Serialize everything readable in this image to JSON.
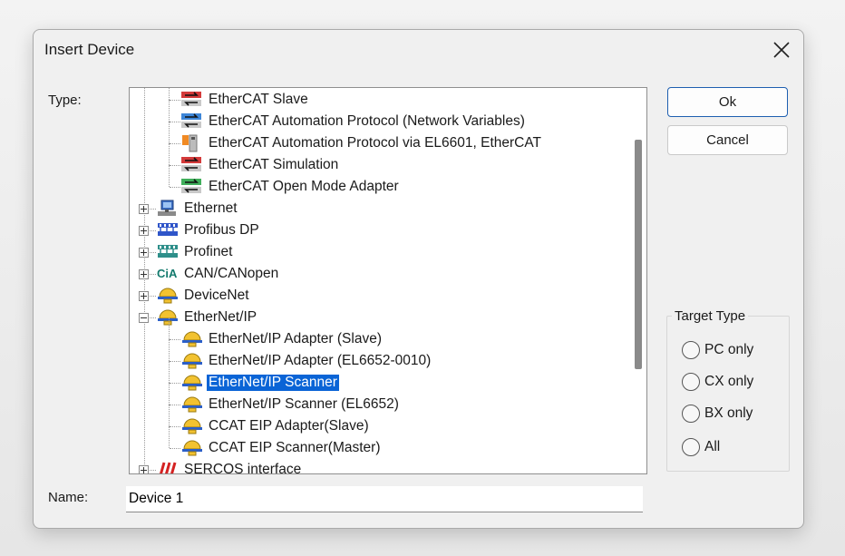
{
  "dialog": {
    "title": "Insert Device",
    "close_icon": "close-icon"
  },
  "type_label": "Type:",
  "tree": {
    "items": [
      {
        "label": "EtherCAT Slave",
        "icon": "ethercat-slave-icon",
        "level": 2
      },
      {
        "label": "EtherCAT Automation Protocol (Network Variables)",
        "icon": "ethercat-automation-icon",
        "level": 2
      },
      {
        "label": "EtherCAT Automation Protocol via EL6601, EtherCAT",
        "icon": "el6601-icon",
        "level": 2
      },
      {
        "label": "EtherCAT Simulation",
        "icon": "ethercat-simulation-icon",
        "level": 2
      },
      {
        "label": "EtherCAT Open Mode Adapter",
        "icon": "ethercat-open-mode-icon",
        "level": 2
      },
      {
        "label": "Ethernet",
        "icon": "ethernet-icon",
        "level": 1,
        "expander": "plus"
      },
      {
        "label": "Profibus DP",
        "icon": "profibus-icon",
        "level": 1,
        "expander": "plus"
      },
      {
        "label": "Profinet",
        "icon": "profinet-icon",
        "level": 1,
        "expander": "plus"
      },
      {
        "label": "CAN/CANopen",
        "icon": "cia-icon",
        "level": 1,
        "expander": "plus"
      },
      {
        "label": "DeviceNet",
        "icon": "devicenet-icon",
        "level": 1,
        "expander": "plus"
      },
      {
        "label": "EtherNet/IP",
        "icon": "ethernetip-icon",
        "level": 1,
        "expander": "minus"
      },
      {
        "label": "EtherNet/IP Adapter (Slave)",
        "icon": "ethernetip-device-icon",
        "level": 2
      },
      {
        "label": "EtherNet/IP Adapter (EL6652-0010)",
        "icon": "ethernetip-device-icon",
        "level": 2
      },
      {
        "label": "EtherNet/IP Scanner",
        "icon": "ethernetip-device-icon",
        "level": 2,
        "selected": true
      },
      {
        "label": "EtherNet/IP Scanner (EL6652)",
        "icon": "ethernetip-device-icon",
        "level": 2
      },
      {
        "label": "CCAT EIP Adapter(Slave)",
        "icon": "ethernetip-device-icon",
        "level": 2
      },
      {
        "label": "CCAT EIP Scanner(Master)",
        "icon": "ethernetip-device-icon",
        "level": 2
      },
      {
        "label": "SERCOS interface",
        "icon": "sercos-icon",
        "level": 1,
        "expander": "plus"
      }
    ]
  },
  "buttons": {
    "ok": "Ok",
    "cancel": "Cancel"
  },
  "target_type": {
    "legend": "Target Type",
    "options": [
      "PC only",
      "CX only",
      "BX only",
      "All"
    ]
  },
  "name_field": {
    "label": "Name:",
    "value": "Device 1"
  }
}
